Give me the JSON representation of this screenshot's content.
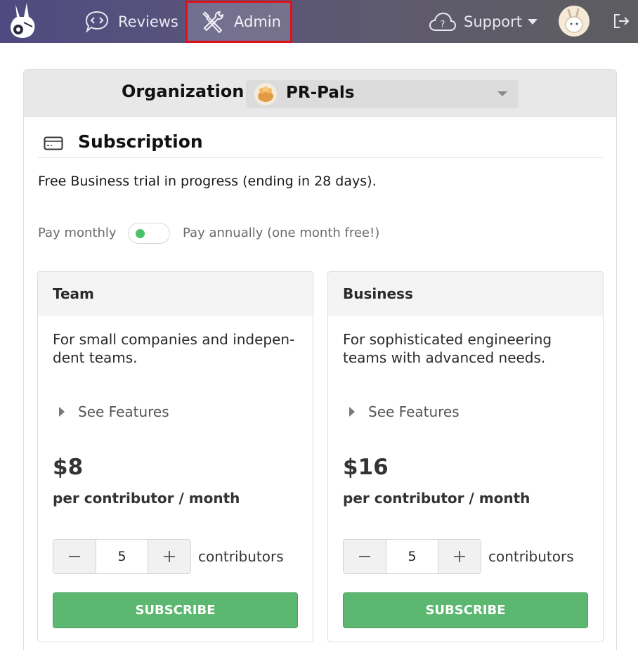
{
  "nav": {
    "reviews_label": "Reviews",
    "admin_label": "Admin",
    "support_label": "Support",
    "icons": [
      "rabbit-logo-icon",
      "code-bubble-icon",
      "tools-icon",
      "help-cloud-icon",
      "chevron-down-icon",
      "user-avatar",
      "logout-icon"
    ]
  },
  "org": {
    "label": "Organization:",
    "name": "PR-Pals"
  },
  "subscription": {
    "title": "Subscription",
    "trial_text": "Free Business trial in progress (ending in 28 days).",
    "pay_monthly": "Pay monthly",
    "pay_annually": "Pay annually (one month free!)"
  },
  "plans": [
    {
      "name": "Team",
      "description": "For small companies and indepen-dent teams.",
      "features_label": "See Features",
      "price": "$8",
      "per": "per contributor / month",
      "contributors_value": "5",
      "contributors_label": "contributors",
      "subscribe_label": "SUBSCRIBE"
    },
    {
      "name": "Business",
      "description": "For sophisticated engineering teams with advanced needs.",
      "features_label": "See Features",
      "price": "$16",
      "per": "per contributor / month",
      "contributors_value": "5",
      "contributors_label": "contributors",
      "subscribe_label": "SUBSCRIBE"
    }
  ],
  "colors": {
    "accent_green": "#5cb870",
    "highlight_red": "#e0101a",
    "nav_bg": "#55517a"
  }
}
